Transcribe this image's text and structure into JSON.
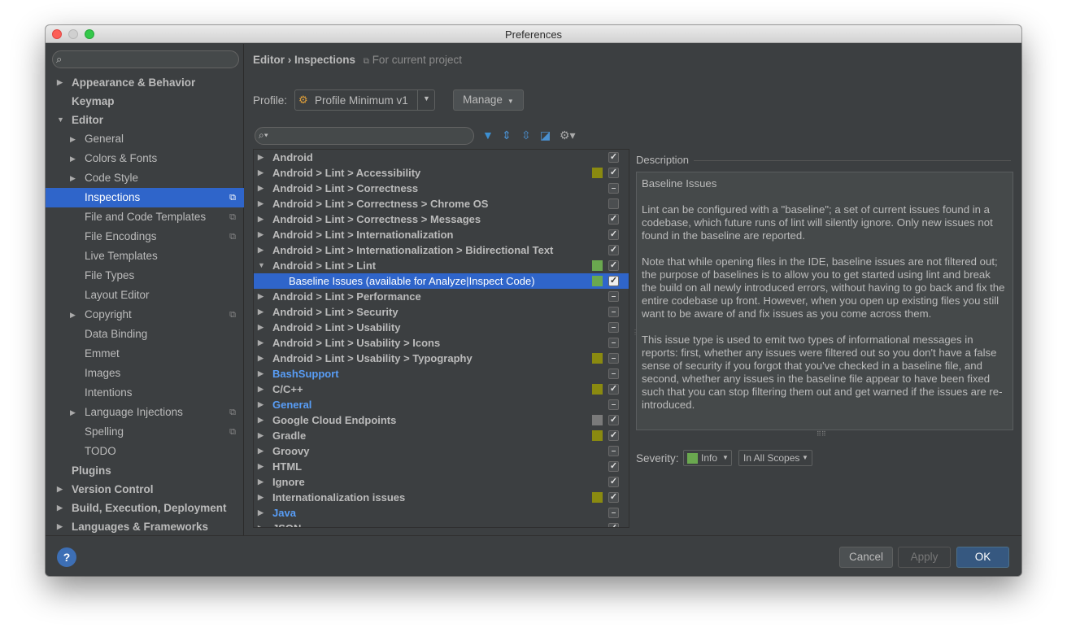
{
  "window": {
    "title": "Preferences"
  },
  "sidebar": {
    "search_placeholder": "",
    "items": [
      {
        "label": "Appearance & Behavior",
        "level": 0,
        "arrow": "▶"
      },
      {
        "label": "Keymap",
        "level": 0,
        "arrow": ""
      },
      {
        "label": "Editor",
        "level": 0,
        "arrow": "▼"
      },
      {
        "label": "General",
        "level": 1,
        "arrow": "▶"
      },
      {
        "label": "Colors & Fonts",
        "level": 1,
        "arrow": "▶"
      },
      {
        "label": "Code Style",
        "level": 1,
        "arrow": "▶"
      },
      {
        "label": "Inspections",
        "level": 1,
        "arrow": "",
        "selected": true,
        "copy": true
      },
      {
        "label": "File and Code Templates",
        "level": 1,
        "arrow": "",
        "copy": true
      },
      {
        "label": "File Encodings",
        "level": 1,
        "arrow": "",
        "copy": true
      },
      {
        "label": "Live Templates",
        "level": 1,
        "arrow": ""
      },
      {
        "label": "File Types",
        "level": 1,
        "arrow": ""
      },
      {
        "label": "Layout Editor",
        "level": 1,
        "arrow": ""
      },
      {
        "label": "Copyright",
        "level": 1,
        "arrow": "▶",
        "copy": true
      },
      {
        "label": "Data Binding",
        "level": 1,
        "arrow": ""
      },
      {
        "label": "Emmet",
        "level": 1,
        "arrow": ""
      },
      {
        "label": "Images",
        "level": 1,
        "arrow": ""
      },
      {
        "label": "Intentions",
        "level": 1,
        "arrow": ""
      },
      {
        "label": "Language Injections",
        "level": 1,
        "arrow": "▶",
        "copy": true
      },
      {
        "label": "Spelling",
        "level": 1,
        "arrow": "",
        "copy": true
      },
      {
        "label": "TODO",
        "level": 1,
        "arrow": ""
      },
      {
        "label": "Plugins",
        "level": 0,
        "arrow": ""
      },
      {
        "label": "Version Control",
        "level": 0,
        "arrow": "▶"
      },
      {
        "label": "Build, Execution, Deployment",
        "level": 0,
        "arrow": "▶"
      },
      {
        "label": "Languages & Frameworks",
        "level": 0,
        "arrow": "▶"
      }
    ]
  },
  "header": {
    "breadcrumb": "Editor › Inspections",
    "scope_note": "For current project"
  },
  "profile": {
    "label": "Profile:",
    "value": "Profile Minimum v1",
    "manage_label": "Manage"
  },
  "filter": {
    "placeholder": ""
  },
  "inspections": [
    {
      "label": "Android",
      "arrow": "▶",
      "check": "checked"
    },
    {
      "label": "Android > Lint > Accessibility",
      "arrow": "▶",
      "color": "#8a8a10",
      "check": "checked"
    },
    {
      "label": "Android > Lint > Correctness",
      "arrow": "▶",
      "check": "dash"
    },
    {
      "label": "Android > Lint > Correctness > Chrome OS",
      "arrow": "▶",
      "check": "empty"
    },
    {
      "label": "Android > Lint > Correctness > Messages",
      "arrow": "▶",
      "check": "checked"
    },
    {
      "label": "Android > Lint > Internationalization",
      "arrow": "▶",
      "check": "checked"
    },
    {
      "label": "Android > Lint > Internationalization > Bidirectional Text",
      "arrow": "▶",
      "check": "checked"
    },
    {
      "label": "Android > Lint > Lint",
      "arrow": "▼",
      "color": "#6aa84f",
      "check": "checked"
    },
    {
      "label": "Baseline Issues (available for Analyze|Inspect Code)",
      "arrow": "",
      "child": true,
      "selected": true,
      "color": "#6aa84f",
      "check": "checked"
    },
    {
      "label": "Android > Lint > Performance",
      "arrow": "▶",
      "check": "dash"
    },
    {
      "label": "Android > Lint > Security",
      "arrow": "▶",
      "check": "dash"
    },
    {
      "label": "Android > Lint > Usability",
      "arrow": "▶",
      "check": "dash"
    },
    {
      "label": "Android > Lint > Usability > Icons",
      "arrow": "▶",
      "check": "dash"
    },
    {
      "label": "Android > Lint > Usability > Typography",
      "arrow": "▶",
      "color": "#8a8a10",
      "check": "dash"
    },
    {
      "label": "BashSupport",
      "arrow": "▶",
      "blue": true,
      "check": "dash"
    },
    {
      "label": "C/C++",
      "arrow": "▶",
      "color": "#8a8a10",
      "check": "checked"
    },
    {
      "label": "General",
      "arrow": "▶",
      "blue": true,
      "check": "dash"
    },
    {
      "label": "Google Cloud Endpoints",
      "arrow": "▶",
      "color": "#7a7a7a",
      "check": "checked"
    },
    {
      "label": "Gradle",
      "arrow": "▶",
      "color": "#8a8a10",
      "check": "checked"
    },
    {
      "label": "Groovy",
      "arrow": "▶",
      "check": "dash"
    },
    {
      "label": "HTML",
      "arrow": "▶",
      "check": "checked"
    },
    {
      "label": "Ignore",
      "arrow": "▶",
      "check": "checked"
    },
    {
      "label": "Internationalization issues",
      "arrow": "▶",
      "color": "#8a8a10",
      "check": "checked"
    },
    {
      "label": "Java",
      "arrow": "▶",
      "blue": true,
      "check": "dash"
    },
    {
      "label": "JSON",
      "arrow": "▶",
      "check": "checked"
    }
  ],
  "description": {
    "label": "Description",
    "paragraphs": [
      "Baseline Issues",
      "Lint can be configured with a \"baseline\"; a set of current issues found in a codebase, which future runs of lint will silently ignore. Only new issues not found in the baseline are reported.",
      "Note that while opening files in the IDE, baseline issues are not filtered out; the purpose of baselines is to allow you to get started using lint and break the build on all newly introduced errors, without having to go back and fix the entire codebase up front. However, when you open up existing files you still want to be aware of and fix issues as you come across them.",
      "This issue type is used to emit two types of informational messages in reports: first, whether any issues were filtered out so you don't have a false sense of security if you forgot that you've checked in a baseline file, and second, whether any issues in the baseline file appear to have been fixed such that you can stop filtering them out and get warned if the issues are re-introduced."
    ]
  },
  "severity": {
    "label": "Severity:",
    "value": "Info",
    "color": "#6aa84f",
    "scope_value": "In All Scopes"
  },
  "footer": {
    "help": "?",
    "cancel": "Cancel",
    "apply": "Apply",
    "ok": "OK"
  }
}
